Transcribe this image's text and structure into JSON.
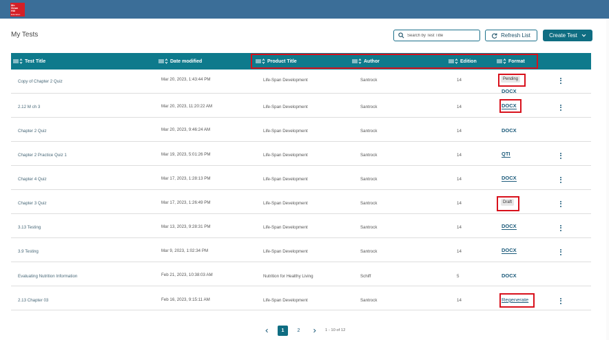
{
  "brand": {
    "logo_lines": [
      "Mc",
      "Graw",
      "Hill",
      "Education"
    ],
    "color": "#d42027"
  },
  "header": {
    "bar_color": "#3b6e98"
  },
  "page": {
    "title": "My Tests"
  },
  "toolbar": {
    "search_placeholder": "Search by Test Title",
    "refresh_label": "Refresh List",
    "create_label": "Create Test"
  },
  "table": {
    "columns": [
      "Test Title",
      "Date modified",
      "Product Title",
      "Author",
      "Edition",
      "Format"
    ],
    "rows": [
      {
        "title": "Copy of Chapter 2 Quiz",
        "date": "Mar 20, 2023, 1:43:44 PM",
        "product": "Life-Span Development",
        "author": "Santrock",
        "edition": "14",
        "status": "Pending",
        "format": "DOCX"
      },
      {
        "title": "2.12 M ch 3",
        "date": "Mar 20, 2023, 11:20:22 AM",
        "product": "Life-Span Development",
        "author": "Santrock",
        "edition": "14",
        "status": "",
        "format": "DOCX"
      },
      {
        "title": "Chapter 2 Quiz",
        "date": "Mar 20, 2023, 9:46:24 AM",
        "product": "Life-Span Development",
        "author": "Santrock",
        "edition": "14",
        "status": "",
        "format": "DOCX"
      },
      {
        "title": "Chapter 2 Practice Quiz 1",
        "date": "Mar 19, 2023, 5:01:26 PM",
        "product": "Life-Span Development",
        "author": "Santrock",
        "edition": "14",
        "status": "",
        "format": "QTI"
      },
      {
        "title": "Chapter 4 Quiz",
        "date": "Mar 17, 2023, 1:28:13 PM",
        "product": "Life-Span Development",
        "author": "Santrock",
        "edition": "14",
        "status": "",
        "format": "DOCX"
      },
      {
        "title": "Chapter 3 Quiz",
        "date": "Mar 17, 2023, 1:26:49 PM",
        "product": "Life-Span Development",
        "author": "Santrock",
        "edition": "14",
        "status": "Draft",
        "format": ""
      },
      {
        "title": "3.13 Testing",
        "date": "Mar 13, 2023, 9:28:31 PM",
        "product": "Life-Span Development",
        "author": "Santrock",
        "edition": "14",
        "status": "",
        "format": "DOCX"
      },
      {
        "title": "3.9 Testing",
        "date": "Mar 9, 2023, 1:02:34 PM",
        "product": "Life-Span Development",
        "author": "Santrock",
        "edition": "14",
        "status": "",
        "format": "DOCX"
      },
      {
        "title": "Evaluating Nutrition Information",
        "date": "Feb 21, 2023, 10:38:03 AM",
        "product": "Nutrition for Healthy Living",
        "author": "Schiff",
        "edition": "5",
        "status": "",
        "format": "DOCX"
      },
      {
        "title": "2.13 Chapter 03",
        "date": "Feb 16, 2023, 9:15:11 AM",
        "product": "Life-Span Development",
        "author": "Santrock",
        "edition": "14",
        "status": "",
        "format": "Regenerate"
      }
    ]
  },
  "pagination": {
    "pages": [
      "1",
      "2"
    ],
    "current": "1",
    "range_text": "1 - 10 of 12"
  },
  "colors": {
    "accent": "#0f6d82",
    "table_header": "#0e7a8c",
    "highlight": "#d8101b",
    "link": "#1b5a7a"
  }
}
